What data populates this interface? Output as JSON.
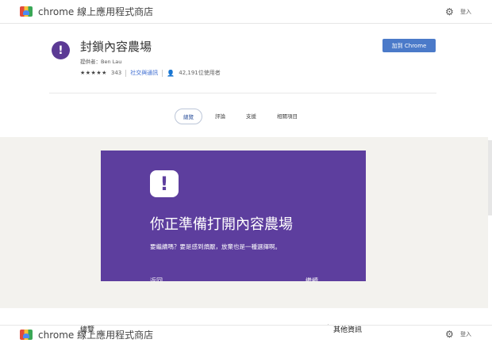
{
  "store": {
    "title": "chrome 線上應用程式商店",
    "login_label": "登入"
  },
  "extension": {
    "name": "封鎖內容農場",
    "provider": "提供者：Ben Lau",
    "stars": "★★★★★",
    "rating_count": "343",
    "category": "社交與通訊",
    "users": "42,191位使用者",
    "add_button": "加到 Chrome"
  },
  "tabs": [
    {
      "label": "總覽",
      "active": true
    },
    {
      "label": "評論",
      "active": false
    },
    {
      "label": "支援",
      "active": false
    },
    {
      "label": "相關項目",
      "active": false
    }
  ],
  "screenshot": {
    "title": "你正準備打開內容農場",
    "text": "要繼續嗎？要是感到煩厭，放棄也是一種選擇啊。",
    "bottom_left": "返回",
    "bottom_right": "繼續"
  },
  "lower": {
    "overview_heading": "總覽",
    "related_heading": "其他資訊",
    "store_title": "chrome 線上應用程式商店",
    "login_label": "登入"
  },
  "colors": {
    "accent": "#4b7ac9",
    "extension_purple": "#5d3e9e"
  }
}
